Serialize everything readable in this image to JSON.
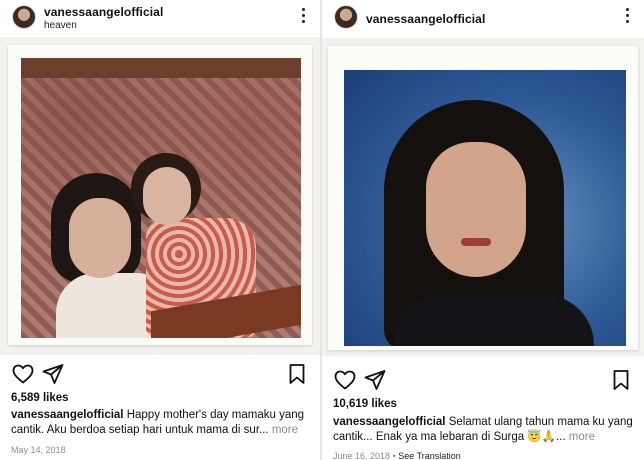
{
  "left_post": {
    "username": "vanessaangelofficial",
    "location": "heaven",
    "likes": "6,589 likes",
    "caption_user": "vanessaangelofficial",
    "caption_text": "Happy mother's day mamaku yang cantik. Aku berdoa setiap hari untuk mama di sur...",
    "more_label": "more",
    "date": "May 14, 2018"
  },
  "right_post": {
    "username": "vanessaangelofficial",
    "likes": "10,619 likes",
    "caption_user": "vanessaangelofficial",
    "caption_text": "Selamat ulang tahun mama ku yang cantik... Enak ya ma lebaran di Surga 😇🙏...",
    "more_label": "more",
    "date": "June 16, 2018",
    "separator": " • ",
    "see_translation": "See Translation"
  },
  "icons": {
    "heart": "heart-icon",
    "share": "send-icon",
    "bookmark": "bookmark-icon",
    "more": "more-vertical-icon"
  }
}
